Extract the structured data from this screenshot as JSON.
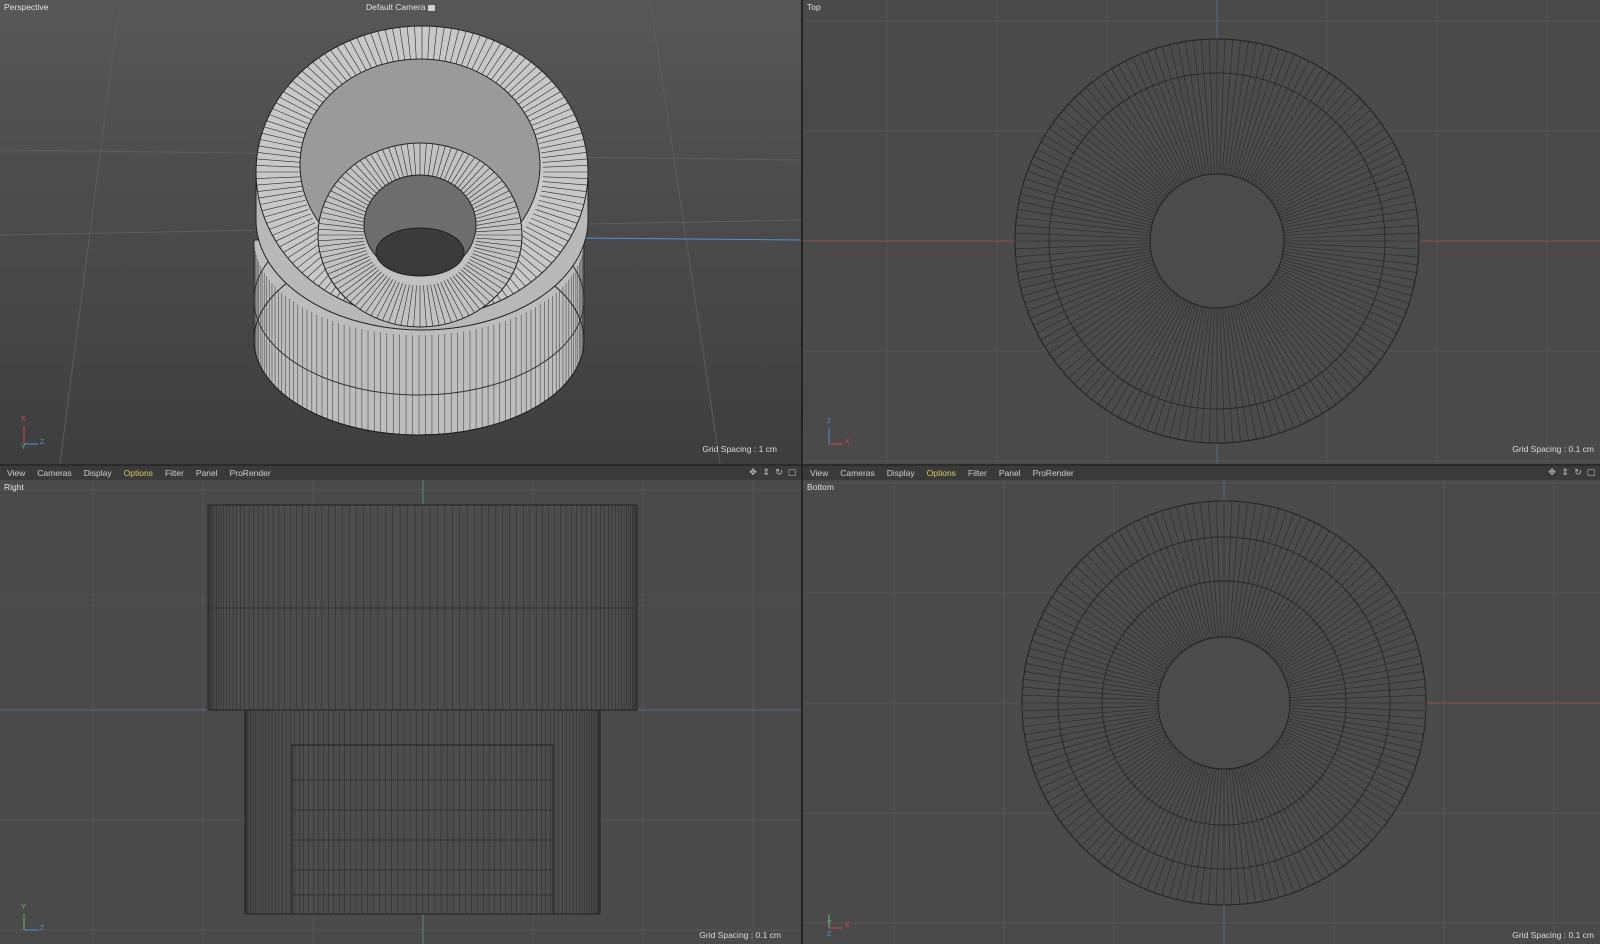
{
  "viewports": {
    "perspective": {
      "title": "Perspective",
      "camera": "Default Camera",
      "grid_spacing": "Grid Spacing : 1 cm",
      "axes": {
        "a": "X",
        "b": "Z",
        "c": "Y"
      }
    },
    "top": {
      "title": "Top",
      "grid_spacing": "Grid Spacing : 0.1 cm",
      "axes": {
        "a": "Z",
        "b": "X"
      }
    },
    "right": {
      "title": "Right",
      "grid_spacing": "Grid Spacing : 0.1 cm",
      "axes": {
        "a": "Y",
        "b": "Z"
      }
    },
    "bottom": {
      "title": "Bottom",
      "grid_spacing": "Grid Spacing : 0.1 cm",
      "axes": {
        "a": "Y",
        "b": "X",
        "c": "Z"
      }
    }
  },
  "menu": {
    "view": "View",
    "cameras": "Cameras",
    "display": "Display",
    "options": "Options",
    "filter": "Filter",
    "panel": "Panel",
    "prorender": "ProRender"
  },
  "colors": {
    "viewport_bg": "#4a4a4a",
    "menu_active": "#d8c96a",
    "axis_x": "#d24a4a",
    "axis_y": "#5fbf5f",
    "axis_z": "#4f8fd8"
  }
}
